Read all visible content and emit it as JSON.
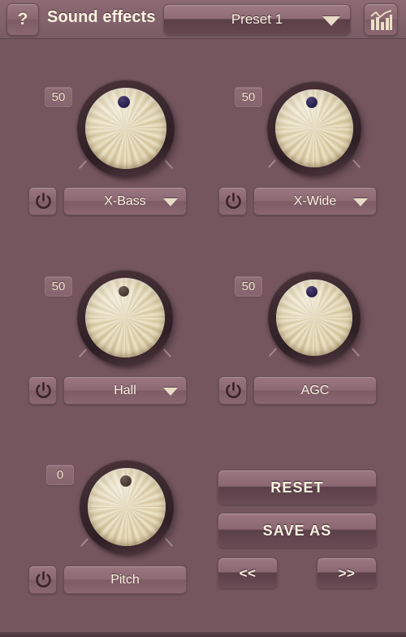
{
  "app": {
    "background_color": "#75565f",
    "accent_text_color": "#fbf1e0"
  },
  "header": {
    "help_label": "?",
    "help_icon": "question-mark-icon",
    "title": "Sound effects",
    "preset": {
      "value": "Preset 1",
      "caret_icon": "chevron-down-icon"
    },
    "equalizer_icon": "equalizer-chart-icon"
  },
  "modules": [
    {
      "id": "x-bass",
      "value": "50",
      "name": "X-Bass",
      "has_dropdown": true,
      "power_icon": "power-icon",
      "caret_icon": "chevron-down-icon",
      "dot_tone": "cool"
    },
    {
      "id": "x-wide",
      "value": "50",
      "name": "X-Wide",
      "has_dropdown": true,
      "power_icon": "power-icon",
      "caret_icon": "chevron-down-icon",
      "dot_tone": "cool"
    },
    {
      "id": "hall",
      "value": "50",
      "name": "Hall",
      "has_dropdown": true,
      "power_icon": "power-icon",
      "caret_icon": "chevron-down-icon",
      "dot_tone": "warm"
    },
    {
      "id": "agc",
      "value": "50",
      "name": "AGC",
      "has_dropdown": false,
      "power_icon": "power-icon",
      "dot_tone": "cool"
    },
    {
      "id": "pitch",
      "value": "0",
      "name": "Pitch",
      "has_dropdown": false,
      "power_icon": "power-icon",
      "dot_tone": "warm"
    }
  ],
  "actions": {
    "reset": "RESET",
    "save_as": "SAVE AS",
    "prev": "<<",
    "next": ">>"
  }
}
